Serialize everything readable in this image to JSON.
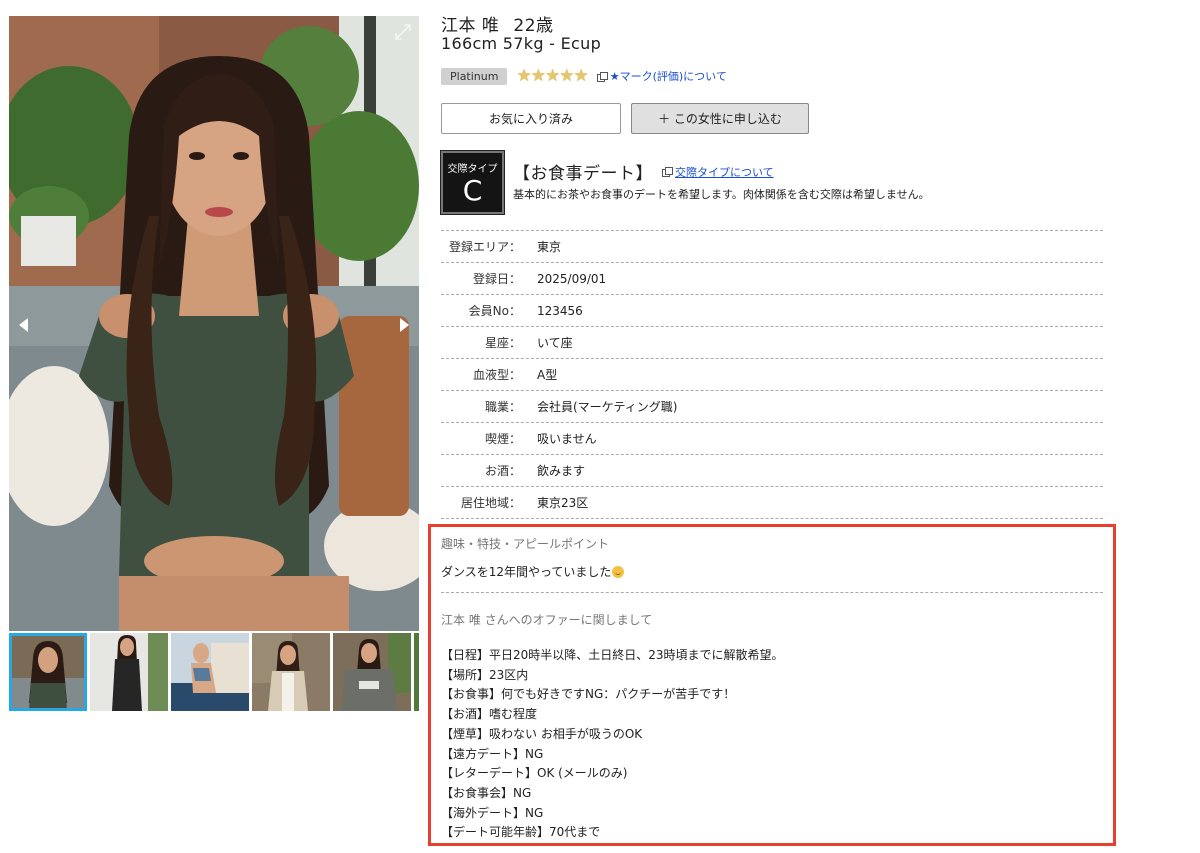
{
  "profile": {
    "name": "江本 唯",
    "age": "22歳",
    "size": "166cm 57kg - Ecup",
    "rank": "Platinum",
    "stars": 5,
    "rating_link": "★マーク(評価)について"
  },
  "buttons": {
    "favorite": "お気に入り済み",
    "apply": "＋ この女性に申し込む"
  },
  "date_type": {
    "label": "交際タイプ",
    "letter": "C",
    "title": "【お食事デート】",
    "link": "交際タイプについて",
    "description": "基本的にお茶やお食事のデートを希望します。肉体関係を含む交際は希望しません。"
  },
  "info": [
    {
      "key": "登録エリア：",
      "value": "東京"
    },
    {
      "key": "登録日：",
      "value": "2025/09/01"
    },
    {
      "key": "会員No：",
      "value": "123456"
    },
    {
      "key": "星座：",
      "value": "いて座"
    },
    {
      "key": "血液型：",
      "value": "A型"
    },
    {
      "key": "職業：",
      "value": "会社員(マーケティング職)"
    },
    {
      "key": "喫煙：",
      "value": "吸いません"
    },
    {
      "key": "お酒：",
      "value": "飲みます"
    },
    {
      "key": "居住地域：",
      "value": "東京23区"
    }
  ],
  "appeal": {
    "label": "趣味・特技・アピールポイント",
    "text": "ダンスを12年間やっていました"
  },
  "offer": {
    "label": "江本 唯 さんへのオファーに関しまして",
    "lines": [
      "【日程】平日20時半以降、土日終日、23時頃までに解散希望。",
      "【場所】23区内",
      "【お食事】何でも好きですNG：パクチーが苦手です！",
      "【お酒】嗜む程度",
      "【煙草】吸わない お相手が吸うのOK",
      "【遠方デート】NG",
      "【レターデート】OK (メールのみ)",
      "【お食事会】NG",
      "【海外デート】NG",
      "【デート可能年齢】70代まで"
    ]
  },
  "colors": {
    "highlight": "#e8402e",
    "link": "#1a4fd1",
    "thumb_active": "#29a8e0",
    "star": "#e6c66a"
  }
}
